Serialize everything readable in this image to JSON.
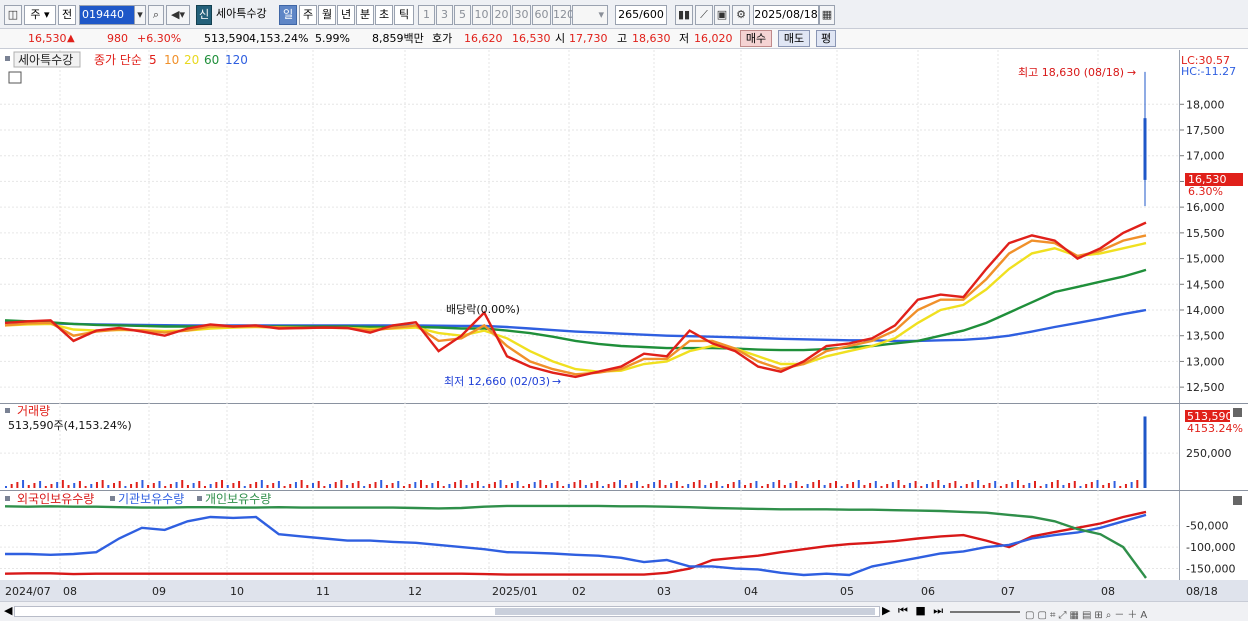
{
  "toolbar": {
    "mode": "주",
    "prev": "전",
    "code": "019440",
    "badge": "신",
    "name": "세아특수강",
    "periods": [
      "일",
      "주",
      "월",
      "년",
      "분",
      "초",
      "틱"
    ],
    "selected_period": "일",
    "intervals": [
      "1",
      "3",
      "5",
      "10",
      "20",
      "30",
      "60",
      "120"
    ],
    "count": "265",
    "count_max": "/600",
    "date": "2025/08/18"
  },
  "quote": {
    "price": "16,530",
    "arrow": "▲",
    "change": "980",
    "change_pct": "+6.30%",
    "volume": "513,590",
    "volume_pct": "4,153.24%",
    "turnover": "5.99%",
    "amount": "8,859백만",
    "bid_label": "호가",
    "bid1": "16,620",
    "bid2": "16,530",
    "open_label": "시",
    "open": "17,730",
    "high_label": "고",
    "high": "18,630",
    "low_label": "저",
    "low": "16,020",
    "buy": "매수",
    "sell": "매도",
    "avg": "평"
  },
  "legend": {
    "name": "세아특수강",
    "ma_label": "종가 단순",
    "ma_periods": [
      "5",
      "10",
      "20",
      "60",
      "120"
    ],
    "ma_colors": [
      "#e0201a",
      "#f0902a",
      "#f0e020",
      "#1f8f3a",
      "#2f5fe0"
    ]
  },
  "price_panel": {
    "lc": "LC:30.57",
    "hc": "HC:-11.27",
    "high_note": "최고 18,630 (08/18)",
    "low_note": "최저 12,660 (02/03)",
    "dividend_note": "배당락(0.00%)",
    "last_price": "16,530",
    "last_pct": "6.30%"
  },
  "volume_panel": {
    "title": "거래량",
    "summary": "513,590주(4,153.24%)",
    "last_volume": "513,590",
    "last_pct": "4153.24%"
  },
  "holdings_panel": {
    "labels": [
      "외국인보유수량",
      "기관보유수량",
      "개인보유수량"
    ]
  },
  "chart_data": {
    "type": "line",
    "title": "세아특수강",
    "x_labels": [
      "2024/07",
      "08",
      "09",
      "10",
      "11",
      "12",
      "2025/01",
      "02",
      "03",
      "04",
      "05",
      "06",
      "07",
      "08",
      "08/18"
    ],
    "price": {
      "ylim": [
        12250,
        18900
      ],
      "ticks": [
        18000,
        17500,
        17000,
        16500,
        16000,
        15500,
        15000,
        14500,
        14000,
        13500,
        13000,
        12500
      ],
      "tick_labels": [
        "18,000",
        "17,500",
        "17,000",
        "16,500",
        "16,000",
        "15,500",
        "15,000",
        "14,500",
        "14,000",
        "13,500",
        "13,000",
        "12,500"
      ],
      "series": [
        {
          "name": "5",
          "color": "#e0201a",
          "values": [
            13750,
            13780,
            13800,
            13400,
            13600,
            13650,
            13580,
            13500,
            13640,
            13720,
            13680,
            13700,
            13640,
            13650,
            13660,
            13650,
            13560,
            13700,
            13760,
            13200,
            13500,
            13950,
            13100,
            12900,
            12780,
            12700,
            12800,
            12900,
            13150,
            13100,
            13600,
            13350,
            13200,
            12900,
            12800,
            13000,
            13300,
            13350,
            13450,
            13700,
            14200,
            14300,
            14250,
            14800,
            15300,
            15450,
            15350,
            15000,
            15200,
            15500,
            15700
          ]
        },
        {
          "name": "10",
          "color": "#f0902a",
          "values": [
            13700,
            13740,
            13750,
            13500,
            13580,
            13620,
            13600,
            13560,
            13600,
            13680,
            13680,
            13680,
            13660,
            13650,
            13655,
            13650,
            13600,
            13650,
            13700,
            13400,
            13450,
            13700,
            13300,
            13000,
            12850,
            12750,
            12780,
            12850,
            13050,
            13050,
            13400,
            13400,
            13250,
            13000,
            12850,
            12950,
            13200,
            13300,
            13400,
            13600,
            14000,
            14200,
            14200,
            14600,
            15100,
            15350,
            15300,
            15050,
            15150,
            15350,
            15450
          ]
        },
        {
          "name": "20",
          "color": "#f0e020",
          "values": [
            13700,
            13720,
            13730,
            13620,
            13600,
            13610,
            13610,
            13590,
            13600,
            13640,
            13660,
            13670,
            13660,
            13655,
            13655,
            13650,
            13630,
            13640,
            13660,
            13550,
            13500,
            13600,
            13450,
            13200,
            13000,
            12850,
            12800,
            12820,
            12950,
            13000,
            13200,
            13300,
            13250,
            13100,
            12950,
            12950,
            13100,
            13200,
            13300,
            13450,
            13750,
            14000,
            14100,
            14400,
            14800,
            15100,
            15200,
            15050,
            15100,
            15200,
            15300
          ]
        },
        {
          "name": "60",
          "color": "#1f8f3a",
          "values": [
            13800,
            13780,
            13760,
            13730,
            13710,
            13700,
            13690,
            13680,
            13680,
            13680,
            13680,
            13680,
            13680,
            13680,
            13680,
            13680,
            13670,
            13670,
            13670,
            13660,
            13640,
            13640,
            13600,
            13550,
            13480,
            13400,
            13340,
            13300,
            13280,
            13260,
            13260,
            13260,
            13250,
            13230,
            13220,
            13220,
            13240,
            13270,
            13300,
            13350,
            13400,
            13500,
            13600,
            13750,
            13950,
            14150,
            14350,
            14450,
            14550,
            14650,
            14780
          ]
        },
        {
          "name": "120",
          "color": "#2f5fe0",
          "values": [
            13760,
            13750,
            13740,
            13730,
            13720,
            13715,
            13710,
            13705,
            13700,
            13700,
            13700,
            13700,
            13700,
            13700,
            13700,
            13700,
            13700,
            13700,
            13700,
            13695,
            13690,
            13690,
            13670,
            13640,
            13610,
            13580,
            13560,
            13540,
            13520,
            13500,
            13490,
            13480,
            13470,
            13455,
            13440,
            13430,
            13420,
            13410,
            13410,
            13400,
            13400,
            13410,
            13420,
            13450,
            13500,
            13580,
            13670,
            13750,
            13830,
            13920,
            14000
          ]
        }
      ],
      "last_candle": {
        "open": 17730,
        "high": 18630,
        "low": 16020,
        "close": 16530
      }
    },
    "volume": {
      "ylim": [
        0,
        560000
      ],
      "ticks": [
        250000
      ],
      "tick_labels": [
        "250,000"
      ],
      "last": 513590
    },
    "holdings": {
      "ylim": [
        -172000,
        5000
      ],
      "ticks": [
        -50000,
        -100000,
        -150000
      ],
      "tick_labels": [
        "-50,000",
        "-100,000",
        "-150,000"
      ],
      "series": [
        {
          "name": "외국인보유수량",
          "color": "#d81818",
          "values": [
            -162000,
            -161000,
            -161000,
            -163000,
            -162000,
            -162000,
            -162000,
            -162000,
            -162000,
            -162000,
            -162000,
            -162000,
            -162000,
            -162000,
            -162000,
            -162000,
            -162000,
            -162000,
            -162000,
            -162000,
            -162000,
            -163000,
            -164000,
            -164000,
            -164000,
            -164000,
            -164000,
            -164000,
            -164000,
            -160000,
            -150000,
            -130000,
            -125000,
            -120000,
            -112000,
            -105000,
            -98000,
            -93000,
            -90000,
            -86000,
            -80000,
            -75000,
            -72000,
            -85000,
            -100000,
            -75000,
            -65000,
            -55000,
            -45000,
            -30000,
            -18000
          ]
        },
        {
          "name": "기관보유수량",
          "color": "#2f5fe0",
          "values": [
            -116000,
            -116000,
            -118000,
            -116000,
            -112000,
            -80000,
            -55000,
            -60000,
            -40000,
            -30000,
            -32000,
            -30000,
            -70000,
            -75000,
            -80000,
            -85000,
            -85000,
            -88000,
            -90000,
            -95000,
            -100000,
            -105000,
            -112000,
            -113000,
            -115000,
            -118000,
            -120000,
            -125000,
            -135000,
            -130000,
            -145000,
            -145000,
            -150000,
            -152000,
            -160000,
            -165000,
            -162000,
            -165000,
            -145000,
            -135000,
            -125000,
            -115000,
            -110000,
            -100000,
            -95000,
            -80000,
            -72000,
            -66000,
            -55000,
            -40000,
            -25000
          ]
        },
        {
          "name": "개인보유수량",
          "color": "#2f8f4a",
          "values": [
            -5000,
            -6000,
            -5000,
            -6000,
            -6000,
            -7000,
            -8000,
            -8000,
            -7000,
            -7000,
            -8000,
            -8000,
            -7000,
            -8000,
            -8000,
            -8000,
            -8000,
            -8000,
            -9000,
            -10000,
            -9000,
            -6000,
            -4000,
            -4000,
            -4000,
            -4000,
            -4000,
            -5000,
            -5000,
            -6000,
            -7000,
            -9000,
            -10000,
            -11000,
            -12000,
            -12000,
            -12000,
            -13000,
            -13000,
            -14000,
            -15000,
            -16000,
            -18000,
            -20000,
            -25000,
            -30000,
            -40000,
            -58000,
            -70000,
            -100000,
            -172000
          ]
        }
      ]
    }
  },
  "status_bar": {
    "left_arrow": "◀",
    "controls": "▶ ⏮ ■ ⏭"
  }
}
